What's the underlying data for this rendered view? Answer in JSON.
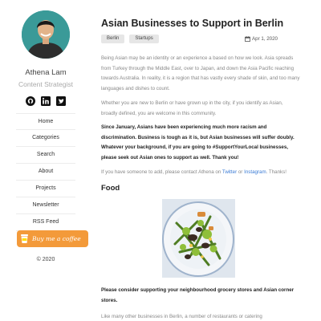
{
  "sidebar": {
    "author_name": "Athena Lam",
    "author_role": "Content Strategist",
    "social_icons": [
      "github-icon",
      "linkedin-icon",
      "twitter-icon"
    ],
    "nav_items": [
      {
        "label": "Home"
      },
      {
        "label": "Categories"
      },
      {
        "label": "Search"
      },
      {
        "label": "About"
      },
      {
        "label": "Projects"
      },
      {
        "label": "Newsletter"
      },
      {
        "label": "RSS Feed"
      }
    ],
    "coffee_label": "Buy me a coffee",
    "copyright": "© 2020"
  },
  "post": {
    "title": "Asian Businesses to Support in Berlin",
    "tags": [
      "Berlin",
      "Startups"
    ],
    "date": "Apr 1, 2020",
    "p1": "Being Asian may be an identity or an experience a based on how we look. Asia spreads from Turkey through the Middle East, over to Japan, and down the Asia Pacific reaching towards Australia. In reality, it is a region that has vastly every shade of skin, and too many languages and dishes to count.",
    "p2": "Whether you are new to Berlin or have grown up in the city, if you identify as Asian, broadly defined, you are welcome in this community.",
    "p3": "Since January, Asians have been experiencing much more racism and discrimination. Business is tough as it is, but Asian businesses will suffer doubly. Whatever your background, if you are going to #SupportYourLocal businesses, please seek out Asian ones to support as well. Thank you!",
    "p4_before": "If you have someone to add, please contact Athena on ",
    "p4_link1": "Twitter",
    "p4_mid": " or ",
    "p4_link2": "Instagram",
    "p4_after": ". Thanks!",
    "section_food": "Food",
    "p5": "Please consider supporting your neighbourhood grocery stores and Asian corner stores.",
    "p6": "Like many other businesses in Berlin, a number of restaurants or catering"
  },
  "colors": {
    "accent_link": "#3a7bd5",
    "coffee_button": "#f39a3a",
    "avatar_background": "#3a9a98"
  }
}
